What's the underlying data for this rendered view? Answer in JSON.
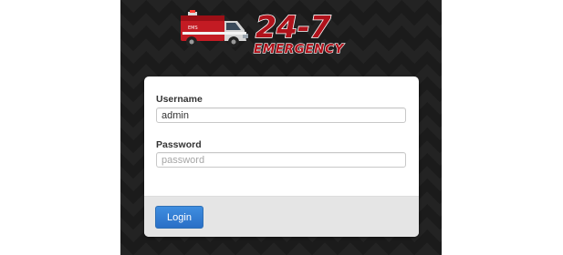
{
  "brand": {
    "logo_line1": "24-7",
    "logo_line2": "EMERGENCY"
  },
  "login_form": {
    "username_label": "Username",
    "username_value": "admin",
    "password_label": "Password",
    "password_placeholder": "password",
    "login_label": "Login"
  },
  "colors": {
    "background": "#1b1b1b",
    "logo_red": "#b0121b",
    "button_blue": "#2a6fc6"
  }
}
